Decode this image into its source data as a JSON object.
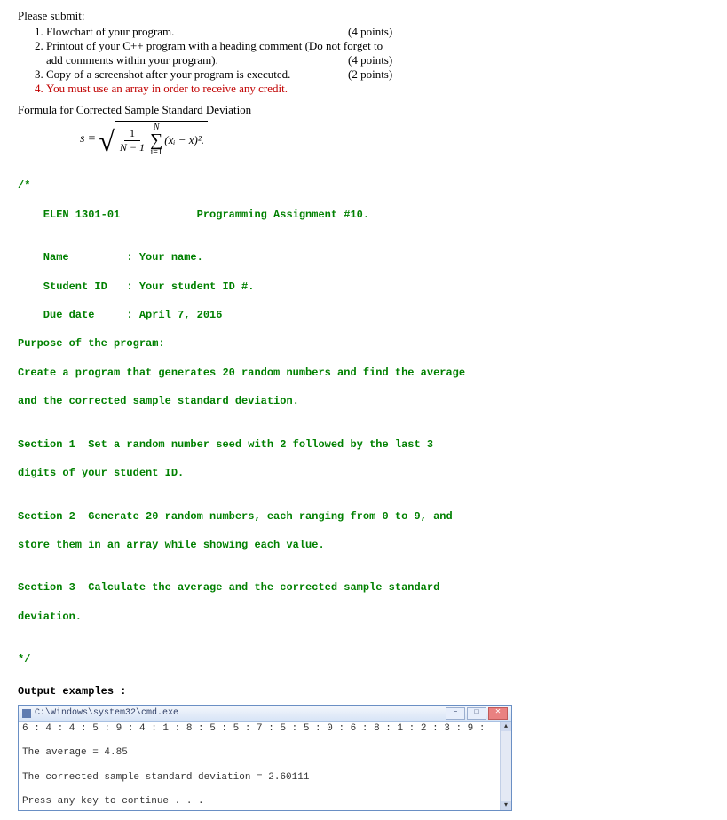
{
  "submit": {
    "head": "Please submit:",
    "items": [
      {
        "text": "Flowchart of your program.",
        "points": "(4 points)"
      },
      {
        "text": "Printout of your C++ program with a heading comment (Do not forget to",
        "points": ""
      },
      {
        "text_cont": "add comments within your program).",
        "points_cont": "(4 points)"
      },
      {
        "text3": "Copy of a screenshot after your program is executed.",
        "points3": "(2 points)"
      },
      {
        "text4": "You must use an array in order to receive any credit."
      }
    ]
  },
  "formula": {
    "head": "Formula for Corrected Sample Standard Deviation",
    "s": "s",
    "frac_num": "1",
    "frac_den": "N − 1",
    "sum_top": "N",
    "sum_bottom": "i=1",
    "term": "(xᵢ − x̄)²."
  },
  "code": {
    "l1": "/*",
    "l2": "    ELEN 1301-01            Programming Assignment #10.",
    "l3": "",
    "l4": "    Name         : Your name.",
    "l5": "    Student ID   : Your student ID #.",
    "l6": "    Due date     : April 7, 2016",
    "l7": "Purpose of the program:",
    "l8": "Create a program that generates 20 random numbers and find the average",
    "l9": "and the corrected sample standard deviation.",
    "l10": "",
    "l11": "Section 1  Set a random number seed with 2 followed by the last 3",
    "l12": "digits of your student ID.",
    "l13": "",
    "l14": "Section 2  Generate 20 random numbers, each ranging from 0 to 9, and",
    "l15": "store them in an array while showing each value.",
    "l16": "",
    "l17": "Section 3  Calculate the average and the corrected sample standard",
    "l18": "deviation.",
    "l19": "",
    "l20": "*/",
    "out_head": "Output examples :"
  },
  "terminal": {
    "title": "C:\\Windows\\system32\\cmd.exe",
    "line1": "6 : 4 : 4 : 5 : 9 : 4 : 1 : 8 : 5 : 5 : 7 : 5 : 5 : 0 : 6 : 8 : 1 : 2 : 3 : 9 :",
    "line2": "The average = 4.85",
    "line3": "The corrected sample standard deviation = 2.60111",
    "line4": "Press any key to continue . . ."
  }
}
